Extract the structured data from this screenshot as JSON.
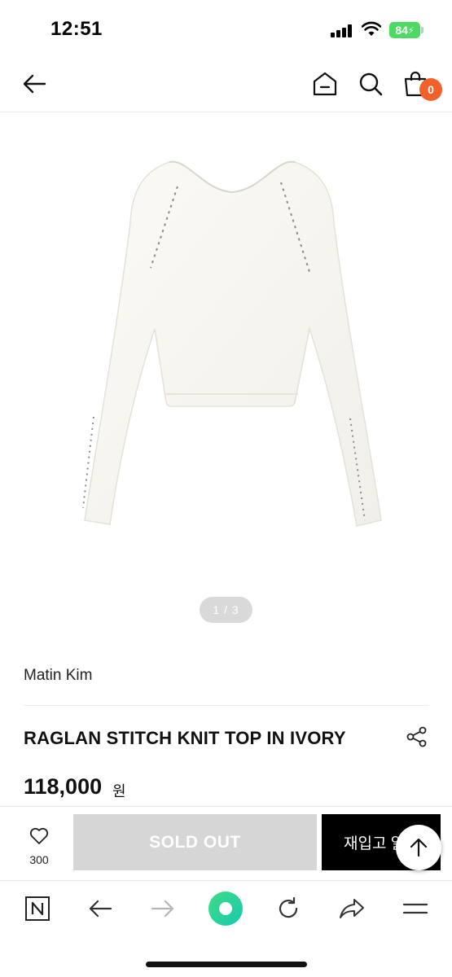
{
  "status_bar": {
    "time": "12:51",
    "battery": "84"
  },
  "header": {
    "cart_count": "0"
  },
  "product": {
    "image_pager": "1 / 3",
    "brand": "Matin Kim",
    "name": "RAGLAN STITCH KNIT TOP IN IVORY",
    "price": "118,000",
    "price_unit": "원"
  },
  "actions": {
    "like_count": "300",
    "sold_out_label": "SOLD OUT",
    "restock_label": "재입고 알림"
  },
  "icons": {
    "header": [
      "back-arrow-icon",
      "home-icon",
      "search-icon",
      "shopping-bag-icon"
    ],
    "browser": [
      "naver-n-icon",
      "back-icon",
      "forward-icon",
      "green-circle-icon",
      "refresh-icon",
      "share-icon",
      "menu-icon"
    ]
  },
  "colors": {
    "badge": "#f0612b",
    "sold_out": "#d6d6d6",
    "restock": "#000000",
    "battery": "#4cd964",
    "browser_center": "#3ddc84"
  }
}
